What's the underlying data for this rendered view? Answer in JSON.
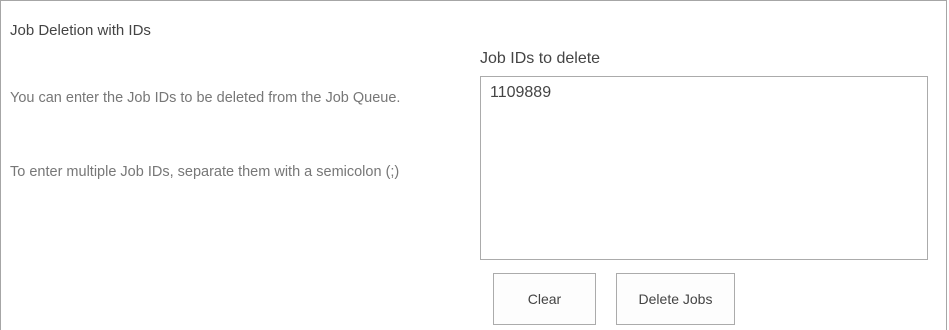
{
  "section": {
    "title": "Job Deletion with IDs",
    "description_1": "You can enter the Job IDs to be deleted from the Job Queue.",
    "description_2": "To enter multiple Job IDs, separate them with a semicolon (;)"
  },
  "job_ids_field": {
    "label": "Job IDs to delete",
    "value": "1109889"
  },
  "buttons": {
    "clear_label": "Clear",
    "delete_label": "Delete Jobs"
  },
  "colors": {
    "border": "#a6a6a6",
    "text_primary": "#444444",
    "text_secondary": "#777777",
    "background": "#ffffff"
  }
}
